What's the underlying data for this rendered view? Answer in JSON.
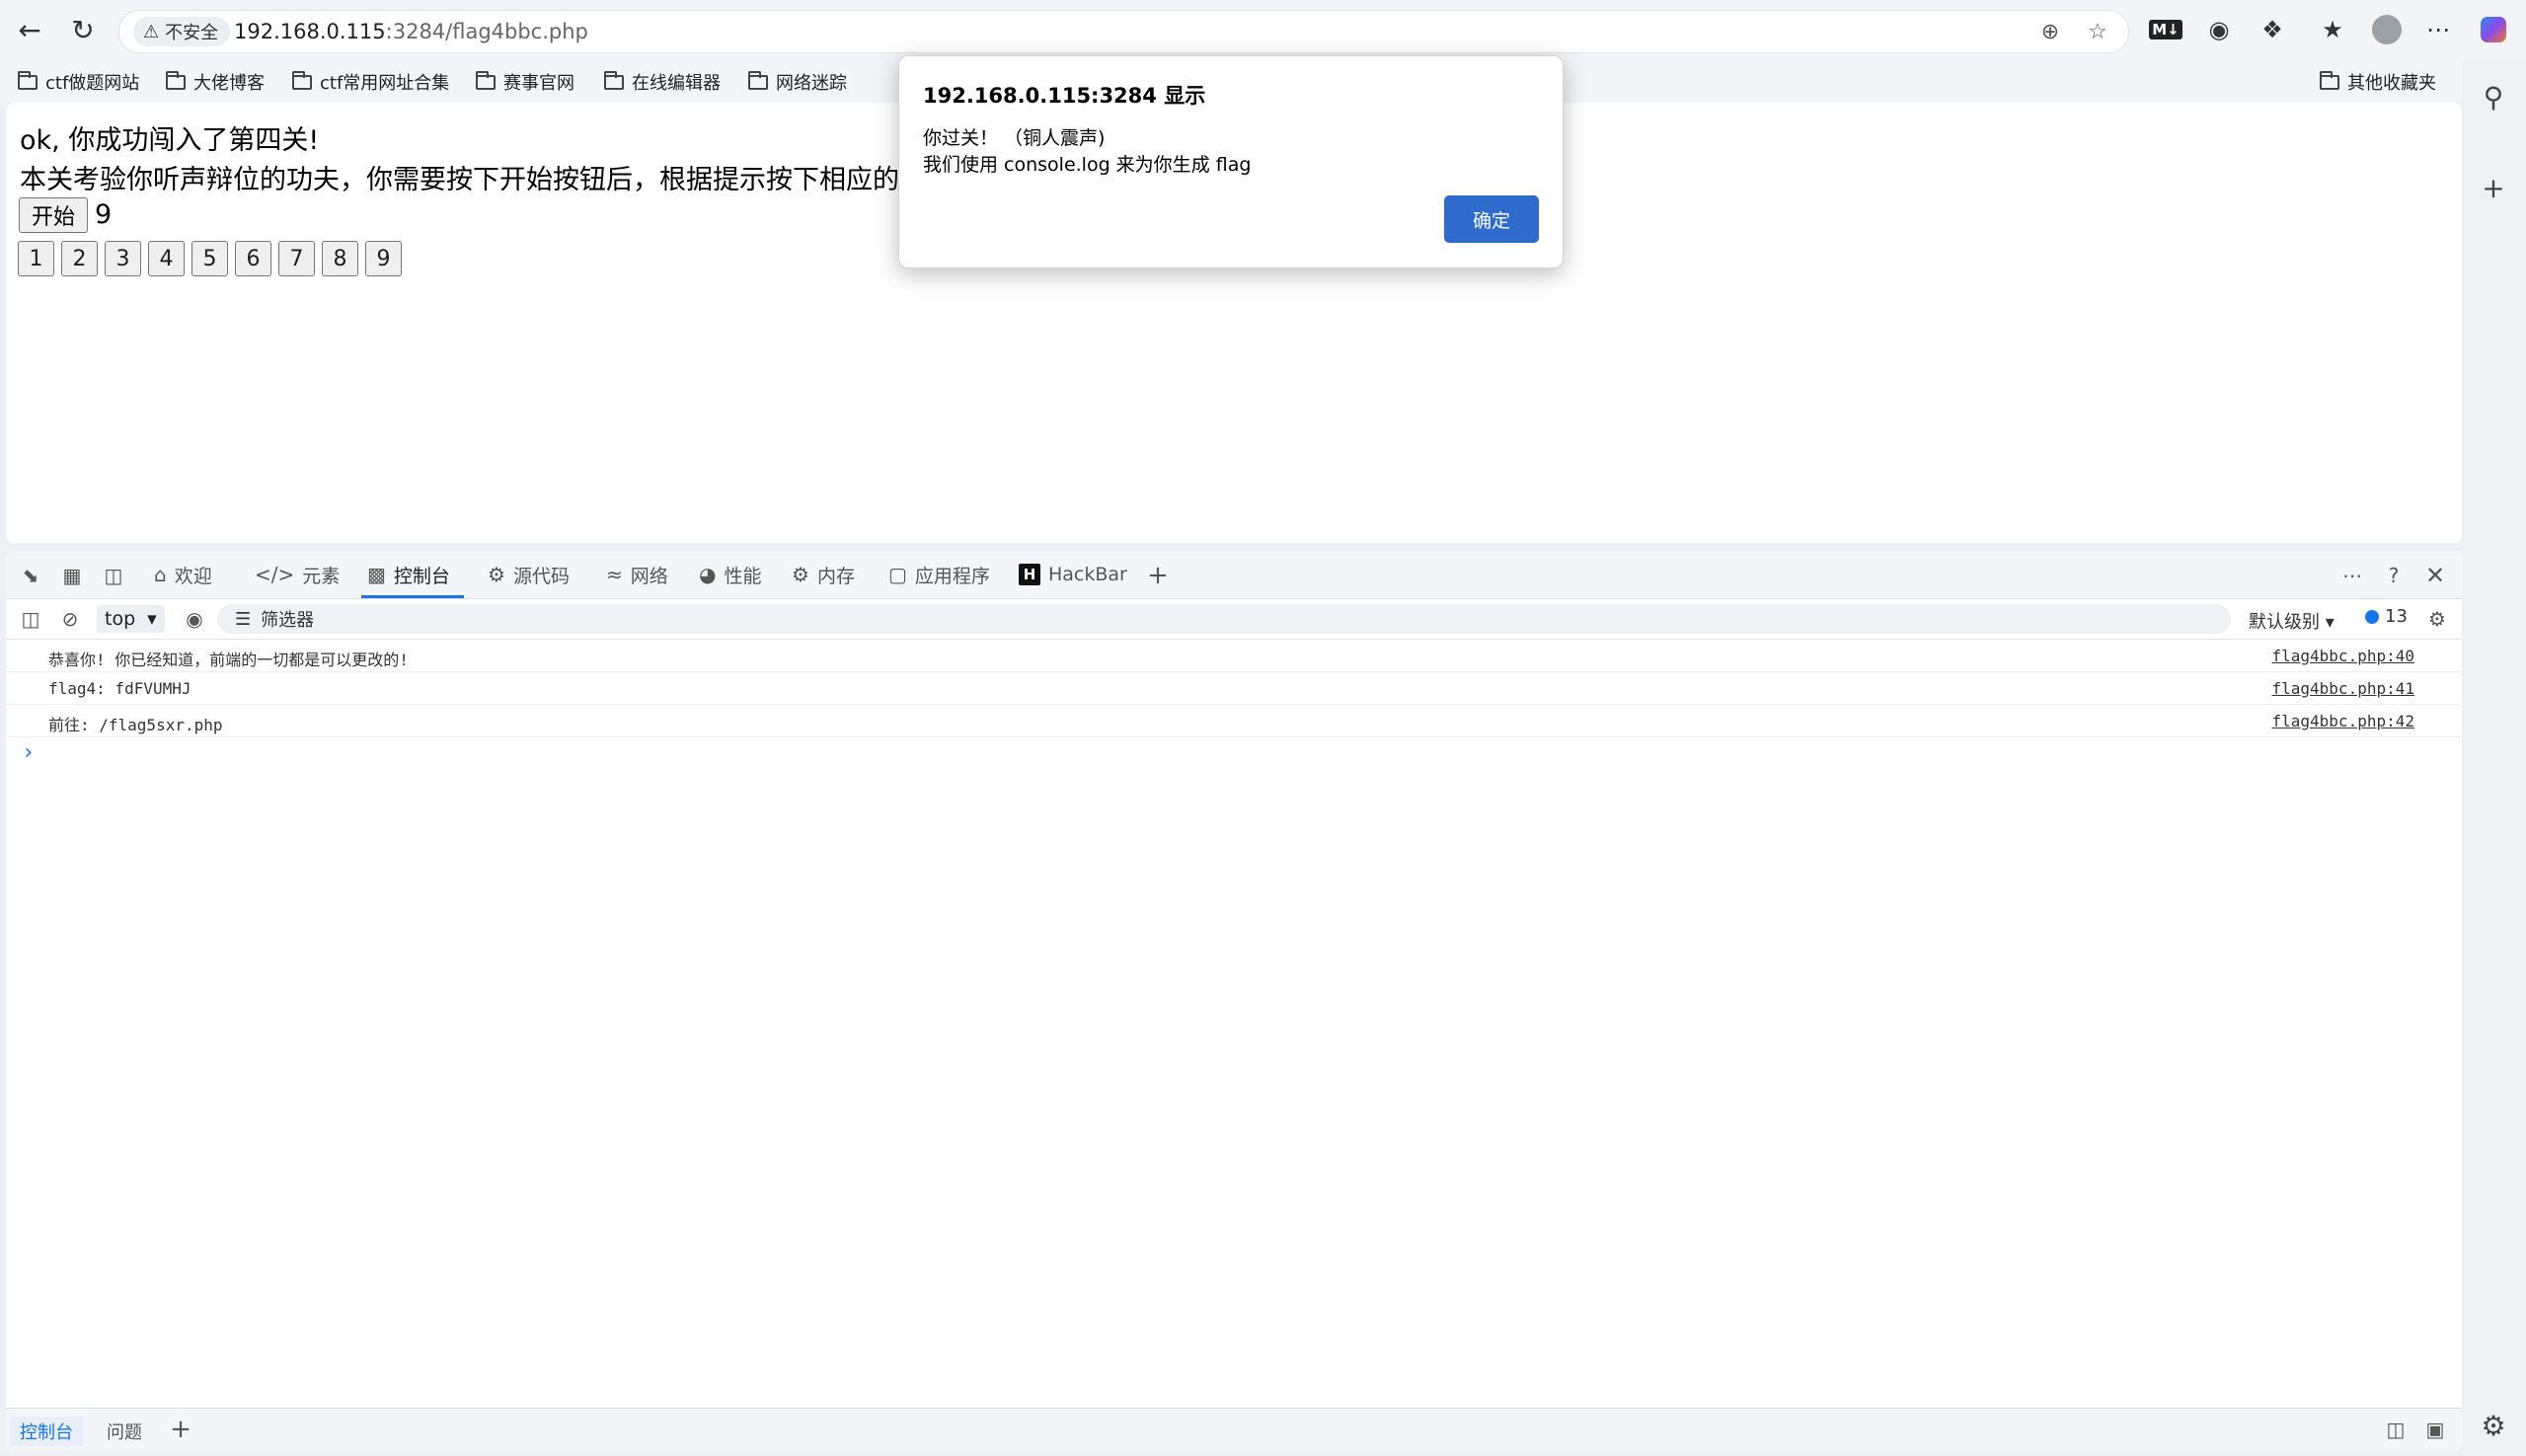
{
  "browser": {
    "security_label": "不安全",
    "url_host": "192.168.0.115",
    "url_rest": ":3284/flag4bbc.php"
  },
  "bookmarks": [
    "ctf做题网站",
    "大佬博客",
    "ctf常用网址合集",
    "赛事官网",
    "在线编辑器",
    "网络迷踪"
  ],
  "bookmarks_other": "其他收藏夹",
  "page": {
    "line1": "ok, 你成功闯入了第四关!",
    "line2": "本关考验你听声辩位的功夫，你需要按下开始按钮后，根据提示按下相应的按",
    "start_label": "开始",
    "counter": "9",
    "numbers": [
      "1",
      "2",
      "3",
      "4",
      "5",
      "6",
      "7",
      "8",
      "9"
    ]
  },
  "dialog": {
    "title": "192.168.0.115:3284 显示",
    "message_line1": "你过关！ （铜人震声)",
    "message_line2": "我们使用 console.log 来为你生成 flag",
    "ok_label": "确定"
  },
  "devtools": {
    "tabs": [
      {
        "label": "欢迎",
        "icon": "home-icon"
      },
      {
        "label": "元素",
        "icon": "code-icon"
      },
      {
        "label": "控制台",
        "icon": "console-icon",
        "active": true
      },
      {
        "label": "源代码",
        "icon": "bug-icon"
      },
      {
        "label": "网络",
        "icon": "wifi-icon"
      },
      {
        "label": "性能",
        "icon": "gauge-icon"
      },
      {
        "label": "内存",
        "icon": "chip-icon"
      },
      {
        "label": "应用程序",
        "icon": "app-icon"
      },
      {
        "label": "HackBar",
        "icon": "hackbar-icon"
      }
    ],
    "context": "top",
    "filter_placeholder": "筛选器",
    "level": "默认级别",
    "issue_count": "13",
    "console_lines": [
      {
        "text": "恭喜你! 你已经知道，前端的一切都是可以更改的!",
        "source": "flag4bbc.php:40"
      },
      {
        "text": "flag4: fdFVUMHJ",
        "source": "flag4bbc.php:41"
      },
      {
        "text": "前往: /flag5sxr.php",
        "source": "flag4bbc.php:42"
      }
    ],
    "drawer_tabs": [
      "控制台",
      "问题"
    ]
  }
}
